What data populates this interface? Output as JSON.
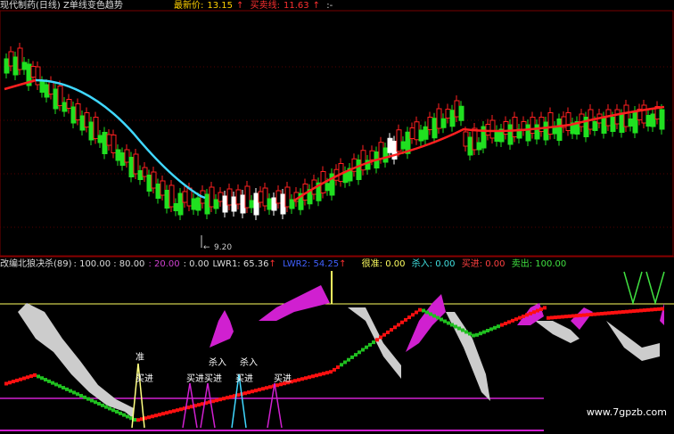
{
  "top": {
    "title": "现代制药(日线) Z单线变色趋势",
    "latest_label": "最新价:",
    "latest_value": "13.15",
    "latest_arrow": "↑",
    "buyline_label": "买卖线:",
    "buyline_value": "11.63",
    "buyline_arrow": "↑",
    "trail": ":-",
    "low_marker": "9.20",
    "colors": {
      "up": "#ff2020",
      "down": "#20e020",
      "ma_down": "#40d8ff",
      "ma_up": "#ff2020"
    }
  },
  "bottom": {
    "title": "改编北狼决杀(89)",
    "v1": ": 100.00 : 80.00",
    "v2": ": 20.00",
    "v3": ": 0.00",
    "lwr1": "LWR1: 65.36",
    "lwr1_arrow": "↑",
    "lwr2": "LWR2: 54.25",
    "lwr2_arrow": "↑",
    "hen": "很准: 0.00",
    "sha": "杀入: 0.00",
    "buy": "买进: 0.00",
    "sell": "卖出: 100.00",
    "signals": [
      "准",
      "买进",
      "买进",
      "买进",
      "买进",
      "杀入",
      "杀入",
      "买进"
    ]
  },
  "watermark": "www.7gpzb.com"
}
